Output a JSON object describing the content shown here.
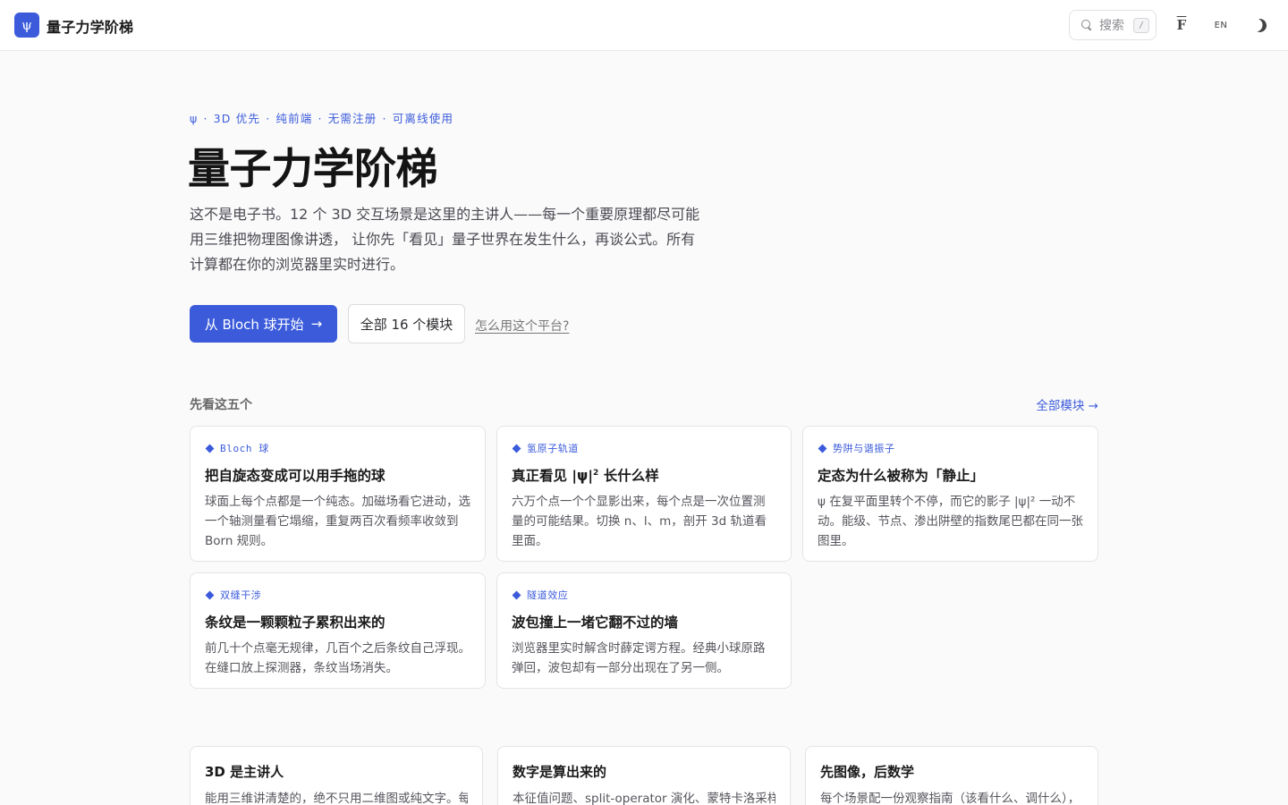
{
  "header": {
    "logo_glyph": "ψ",
    "brand": "量子力学阶梯",
    "search_label": "搜索",
    "search_shortcut": "/",
    "font_toggle": "F",
    "lang_toggle": "EN"
  },
  "hero": {
    "eyebrow": [
      "ψ",
      "3D 优先",
      "纯前端",
      "无需注册",
      "可离线使用"
    ],
    "title": "量子力学阶梯",
    "subtitle": "这不是电子书。12 个 3D 交互场景是这里的主讲人——每一个重要原理都尽可能用三维把物理图像讲透， 让你先「看见」量子世界在发生什么，再谈公式。所有计算都在你的浏览器里实时进行。",
    "primary_button": "从 Bloch 球开始",
    "primary_arrow": "→",
    "secondary_button": "全部 16 个模块",
    "help_link": "怎么用这个平台?"
  },
  "featured": {
    "label": "先看这五个",
    "all_link": "全部模块 →",
    "cards": [
      {
        "tag": "Bloch 球",
        "title": "把自旋态变成可以用手拖的球",
        "desc": "球面上每个点都是一个纯态。加磁场看它进动，选一个轴测量看它塌缩，重复两百次看频率收敛到 Born 规则。"
      },
      {
        "tag": "氢原子轨道",
        "title_pre": "真正看见 |ψ|",
        "title_sup": "2",
        "title_post": " 长什么样",
        "desc": "六万个点一个个显影出来，每个点是一次位置测量的可能结果。切换 n、l、m，剖开 3d 轨道看里面。"
      },
      {
        "tag": "势阱与谐振子",
        "title": "定态为什么被称为「静止」",
        "desc": "ψ 在复平面里转个不停，而它的影子 |ψ|² 一动不动。能级、节点、渗出阱壁的指数尾巴都在同一张图里。"
      },
      {
        "tag": "双缝干涉",
        "title": "条纹是一颗颗粒子累积出来的",
        "desc": "前几十个点毫无规律，几百个之后条纹自己浮现。在缝口放上探测器，条纹当场消失。"
      },
      {
        "tag": "隧道效应",
        "title": "波包撞上一堵它翻不过的墙",
        "desc": "浏览器里实时解含时薛定谔方程。经典小球原路弹回，波包却有一部分出现在了另一侧。"
      }
    ]
  },
  "features": [
    {
      "title": "3D 是主讲人",
      "desc": "能用三维讲清楚的，绝不只用二维图或纯文字。每"
    },
    {
      "title": "数字是算出来的",
      "desc": "本征值问题、split-operator 演化、蒙特卡洛采样全"
    },
    {
      "title": "先图像，后数学",
      "desc": "每个场景配一份观察指南（该看什么、调什么），"
    }
  ],
  "colors": {
    "accent": "#3b5bdb",
    "background": "#fafafa",
    "card": "#ffffff"
  }
}
